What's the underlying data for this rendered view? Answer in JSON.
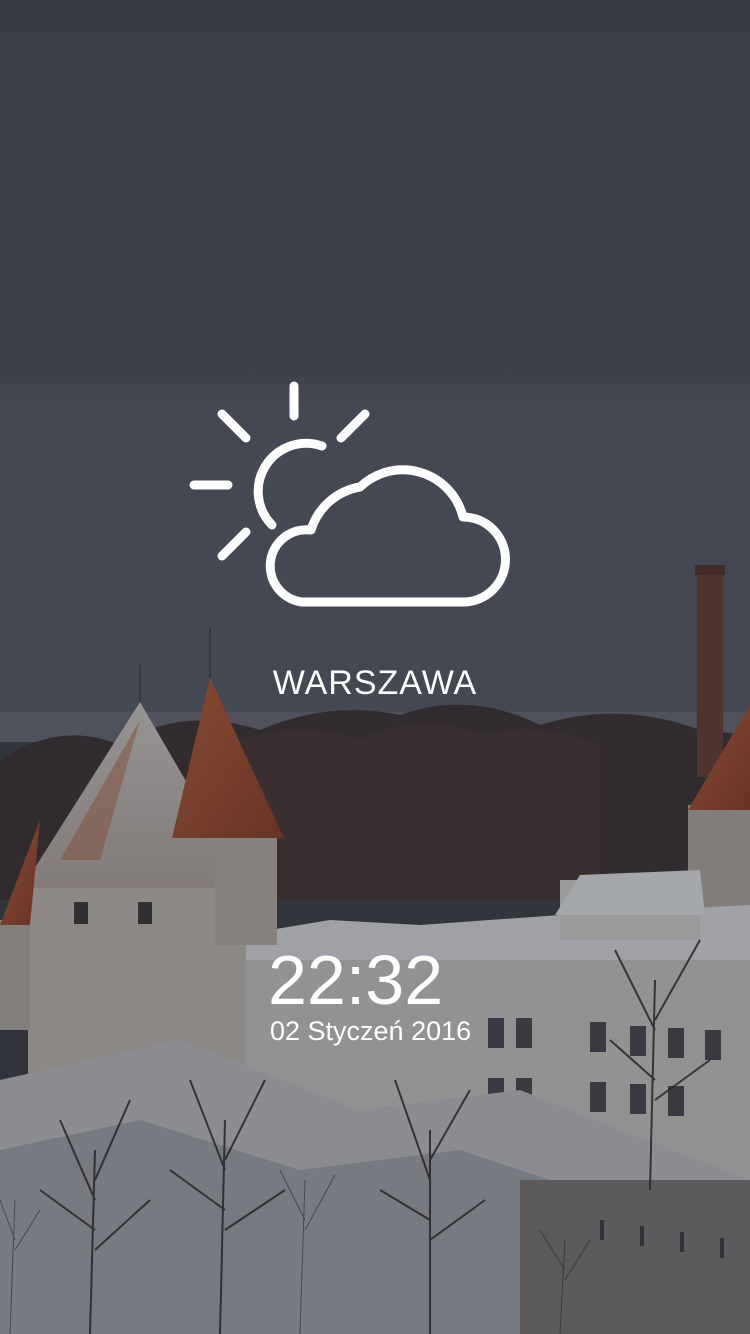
{
  "weather": {
    "icon": "partly-cloudy-icon",
    "city": "WARSZAWA"
  },
  "clock": {
    "time": "22:32",
    "date": "02 Styczeń 2016"
  },
  "background": {
    "scene": "snowy-old-town-photo",
    "sky_color": "#4a4c55",
    "roof_color": "#b5552e",
    "snow_color": "#e4e6ea"
  }
}
